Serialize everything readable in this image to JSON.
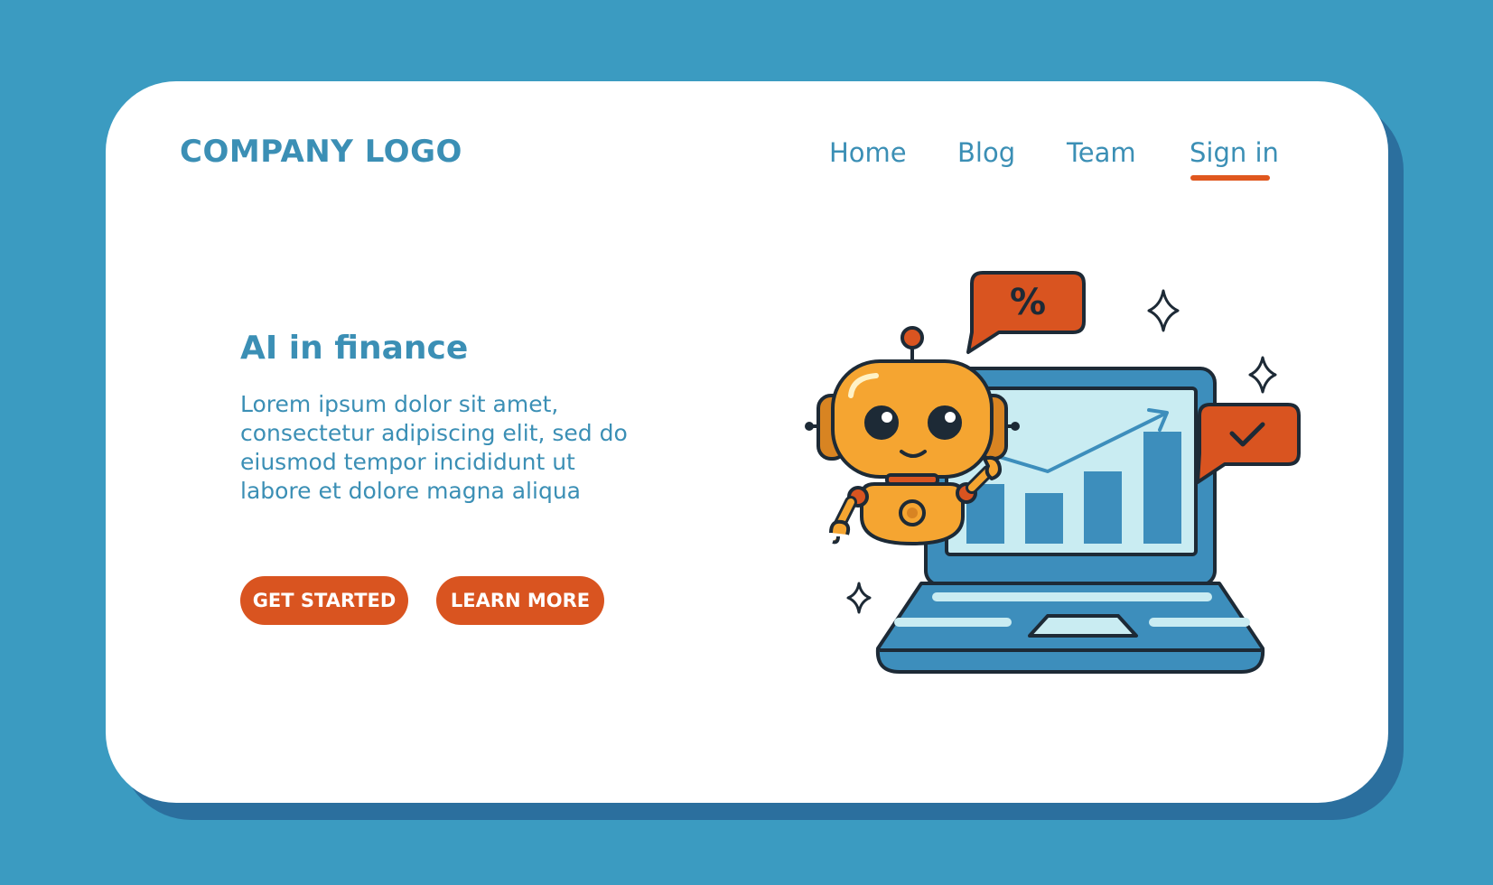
{
  "header": {
    "logo": "COMPANY LOGO",
    "nav": [
      {
        "label": "Home"
      },
      {
        "label": "Blog"
      },
      {
        "label": "Team"
      },
      {
        "label": "Sign in",
        "active": true
      }
    ]
  },
  "hero": {
    "title": "AI in finance",
    "body": "Lorem ipsum dolor sit amet, consectetur adipiscing elit, sed do eiusmod tempor incididunt ut labore et dolore magna aliqua",
    "buttons": {
      "get_started": "GET STARTED",
      "learn_more": "LEARN MORE"
    }
  },
  "illustration": {
    "percent_bubble": "%",
    "icons": [
      "robot-icon",
      "laptop-icon",
      "bar-chart-icon",
      "trend-arrow-icon",
      "percent-bubble-icon",
      "check-bubble-icon",
      "sparkle-icon"
    ]
  },
  "colors": {
    "background": "#3b9bc1",
    "card": "#ffffff",
    "card_shadow": "#2b6f9e",
    "text_primary": "#3b8fb5",
    "accent": "#d95420",
    "robot": "#f5a531",
    "screen": "#c9ecf2"
  }
}
